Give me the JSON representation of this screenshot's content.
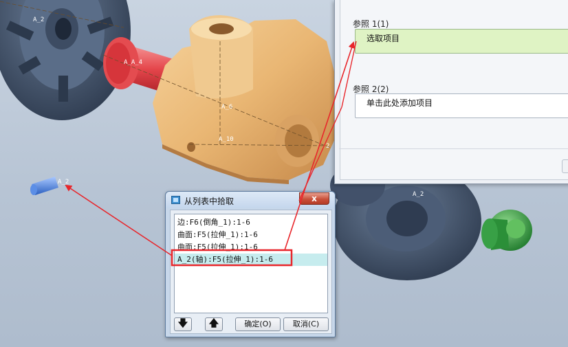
{
  "scene": {
    "axis_labels": [
      "A_2",
      "A_A_4",
      "A_6",
      "A_10",
      "2",
      "A_2",
      "A_2"
    ]
  },
  "reference_panel": {
    "ref1_label": "参照 1(1)",
    "ref1_value": "选取项目",
    "ref2_label": "参照 2(2)",
    "ref2_value": "单击此处添加项目"
  },
  "pick_dialog": {
    "title": "从列表中拾取",
    "close_label": "x",
    "items": [
      "边:F6(倒角_1):1-6",
      "曲面:F5(拉伸_1):1-6",
      "曲面:F5(拉伸_1):1-6",
      "A_2(轴):F5(拉伸_1):1-6"
    ],
    "selected_index": 3,
    "down_label": "🡇",
    "up_label": "🡅",
    "ok_label": "确定(O)",
    "cancel_label": "取消(C)"
  },
  "colors": {
    "annotation_red": "#e8262b",
    "selection_bg": "#c6ecee",
    "active_field_bg": "#dff3c4"
  }
}
